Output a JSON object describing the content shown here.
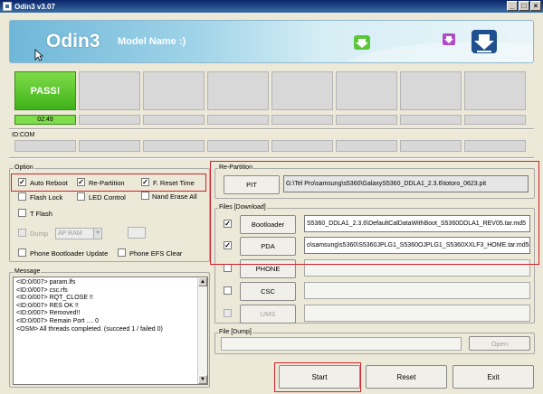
{
  "window": {
    "title": "Odin3 v3.07",
    "controls": [
      "_",
      "□",
      "×"
    ]
  },
  "banner": {
    "title": "Odin3",
    "subtitle": "Model Name :)",
    "icons": [
      "download-arrow-icon",
      "download-arrow-icon",
      "download-arrow-icon"
    ]
  },
  "status": {
    "pass_label": "PASS!",
    "time": "02:49"
  },
  "idcom": {
    "label": "ID:COM"
  },
  "option": {
    "label": "Option",
    "auto_reboot": {
      "label": "Auto Reboot",
      "checked": true
    },
    "re_partition": {
      "label": "Re-Partition",
      "checked": true
    },
    "f_reset_time": {
      "label": "F. Reset Time",
      "checked": true
    },
    "flash_lock": {
      "label": "Flash Lock",
      "checked": false
    },
    "led_control": {
      "label": "LED Control",
      "checked": false
    },
    "nand_erase_all": {
      "label": "Nand Erase All",
      "checked": false
    },
    "t_flash": {
      "label": "T Flash",
      "checked": false
    },
    "dump": {
      "label": "Dump",
      "checked": false,
      "select_value": "AP RAM"
    },
    "phone_bootloader_update": {
      "label": "Phone Bootloader Update",
      "checked": false
    },
    "phone_efs_clear": {
      "label": "Phone EFS Clear",
      "checked": false
    }
  },
  "message": {
    "label": "Message",
    "lines": [
      "<ID:0/007> param.lfs",
      "<ID:0/007> csc.rfs",
      "<ID:0/007> RQT_CLOSE !!",
      "<ID:0/007> RES OK !!",
      "<ID:0/007> Removed!!",
      "<ID:0/007> Remain Port .... 0",
      "<OSM> All threads completed. (succeed 1 / failed 0)"
    ]
  },
  "repartition": {
    "label": "Re-Partition",
    "pit_button": "PIT",
    "pit_path": "G:\\Tel Pro\\samsung\\s5360\\GalaxyS5360_DDLA1_2.3.6\\totoro_0623.pit"
  },
  "files": {
    "label": "Files [Download]",
    "rows": [
      {
        "button": "Bootloader",
        "path": "S5360_DDLA1_2.3.6\\DefaultCalDataWithBoot_S5360DDLA1_REV05.tar.md5",
        "checked": true,
        "enabled": true
      },
      {
        "button": "PDA",
        "path": "o\\samsung\\s5360\\S5360JPLG1_S5360OJPLG1_S5360XXLF3_HOME.tar.md5",
        "checked": true,
        "enabled": true
      },
      {
        "button": "PHONE",
        "path": "",
        "checked": false,
        "enabled": true
      },
      {
        "button": "CSC",
        "path": "",
        "checked": false,
        "enabled": true
      },
      {
        "button": "UMS",
        "path": "",
        "checked": false,
        "enabled": false
      }
    ]
  },
  "file_dump": {
    "label": "File [Dump]",
    "open_button": "Open"
  },
  "actions": {
    "start": "Start",
    "reset": "Reset",
    "exit": "Exit"
  },
  "colors": {
    "pass_green": "#3fb21a",
    "highlight_red": "#d4202a",
    "titlebar_blue": "#0a246a"
  }
}
